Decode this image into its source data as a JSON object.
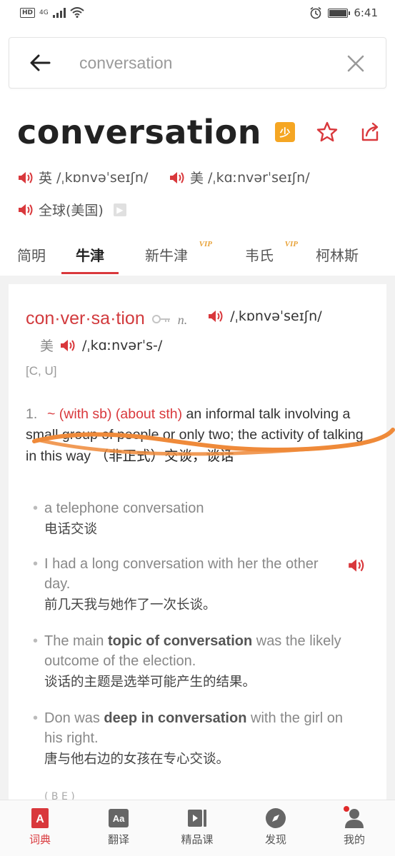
{
  "status_bar": {
    "hd_badge": "HD",
    "network": "4G",
    "time": "6:41",
    "battery_level": 0.9
  },
  "search": {
    "query": "conversation"
  },
  "headword": {
    "word": "conversation",
    "kid_badge": "少"
  },
  "pronunciations": {
    "uk_label": "英",
    "uk_ipa": "/ˌkɒnvəˈseɪʃn/",
    "us_label": "美",
    "us_ipa": "/ˌkɑːnvərˈseɪʃn/",
    "global_label": "全球(美国)"
  },
  "tabs": [
    {
      "label": "简明"
    },
    {
      "label": "牛津"
    },
    {
      "label": "新牛津",
      "badge": "VIP"
    },
    {
      "label": "韦氏",
      "badge": "VIP"
    },
    {
      "label": "柯林斯"
    }
  ],
  "entry": {
    "syllabified": "con·ver·sa·tion",
    "key_symbol": "O",
    "pos": "n.",
    "ipa_uk": "/ˌkɒnvəˈseɪʃn/",
    "us_marker": "美",
    "ipa_us": "/ˌkɑːnvərˈs-/",
    "grammar": "[C, U]"
  },
  "sense": {
    "number": "1.",
    "pattern1": "~ (with sb)",
    "pattern2": "(about sth)",
    "definition": "an informal talk involving a small group of people or only two; the activity of talking in this way",
    "chinese": "（非正式）交谈，谈话"
  },
  "examples": [
    {
      "en": "a telephone conversation",
      "zh": "电话交谈"
    },
    {
      "en": "I had a long conversation with her the other day.",
      "zh": "前几天我与她作了一次长谈。"
    },
    {
      "en_pre": "The main ",
      "en_bold": "topic of conversation",
      "en_post": " was the likely outcome of the election.",
      "zh": "谈话的主题是选举可能产生的结果。"
    },
    {
      "en_pre": "Don was ",
      "en_bold": "deep in conversation",
      "en_post": " with the girl on his right.",
      "zh": "唐与他右边的女孩在专心交谈。"
    }
  ],
  "cut_text": "( B E )",
  "bottom_nav": [
    {
      "label": "词典",
      "icon": "dictionary-icon"
    },
    {
      "label": "翻译",
      "icon": "translate-icon"
    },
    {
      "label": "精品课",
      "icon": "course-icon"
    },
    {
      "label": "发现",
      "icon": "discover-icon"
    },
    {
      "label": "我的",
      "icon": "profile-icon"
    }
  ],
  "colors": {
    "accent": "#d9383c",
    "kid_badge": "#f5a623",
    "vip": "#e8a33a",
    "annotation": "#ef8a3a"
  }
}
